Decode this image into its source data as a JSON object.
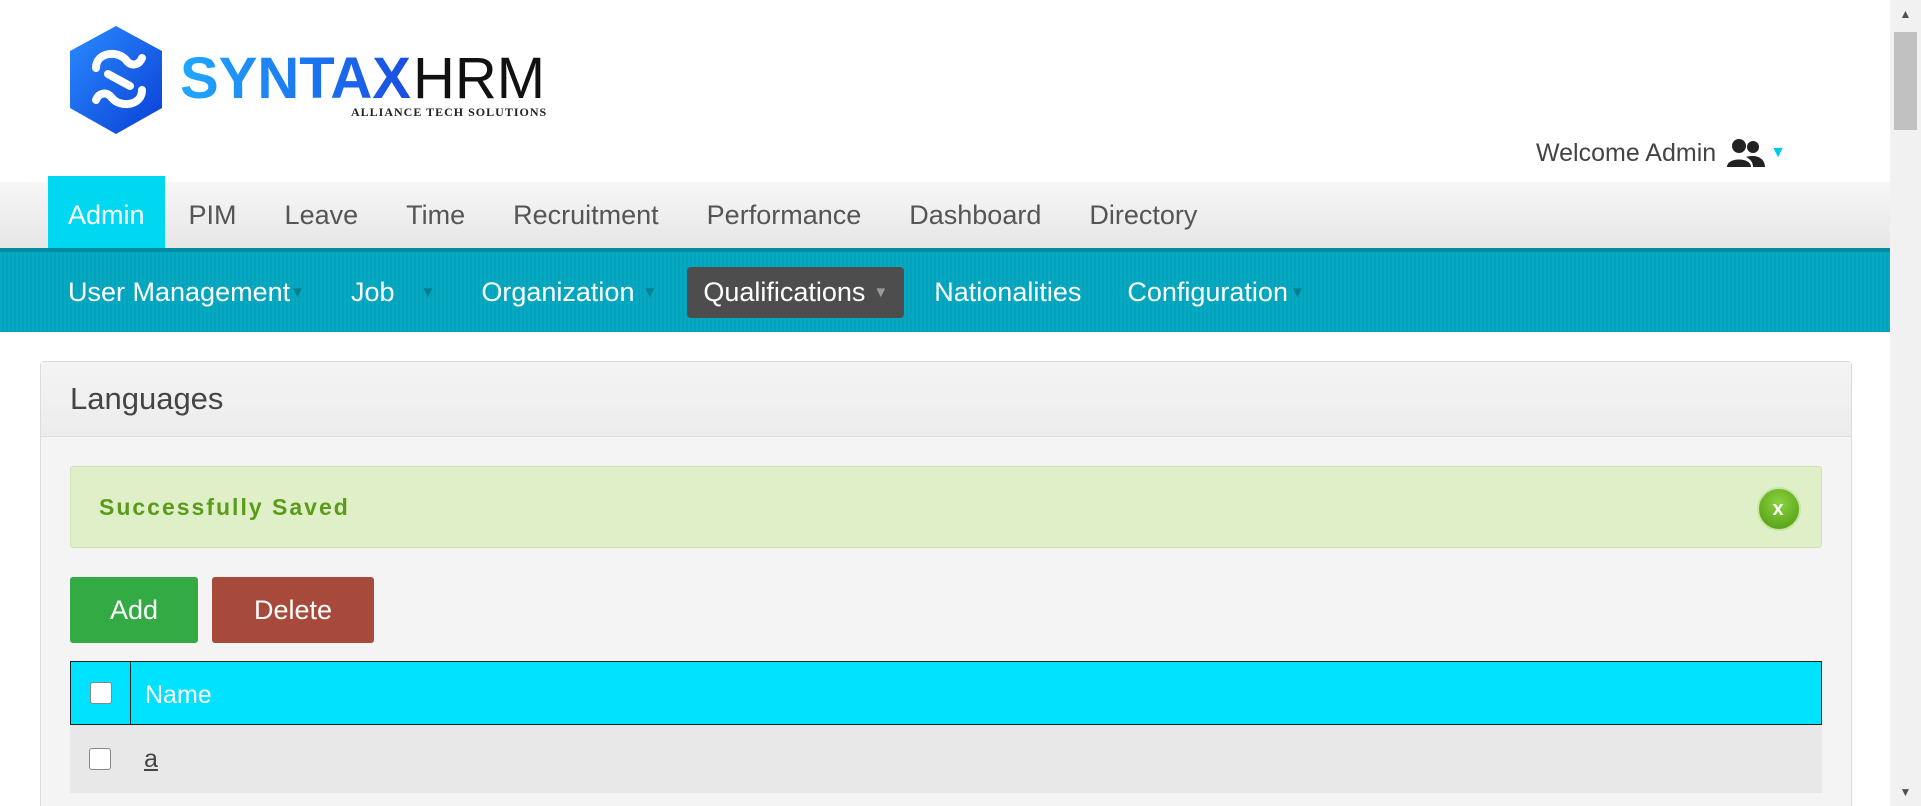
{
  "brand": {
    "logo_text_primary": "SYNTAX",
    "logo_text_secondary": "HRM",
    "tagline": "ALLIANCE TECH SOLUTIONS",
    "colors": {
      "primary": "#1a8cff",
      "secondary": "#111111"
    }
  },
  "header": {
    "welcome_text": "Welcome Admin",
    "user_icon": "users-icon"
  },
  "main_menu": {
    "items": [
      {
        "label": "Admin",
        "active": true
      },
      {
        "label": "PIM"
      },
      {
        "label": "Leave"
      },
      {
        "label": "Time"
      },
      {
        "label": "Recruitment"
      },
      {
        "label": "Performance"
      },
      {
        "label": "Dashboard"
      },
      {
        "label": "Directory"
      }
    ]
  },
  "sub_menu": {
    "items": [
      {
        "label": "User Management",
        "has_dropdown": true
      },
      {
        "label": "Job",
        "has_dropdown": true
      },
      {
        "label": "Organization",
        "has_dropdown": true
      },
      {
        "label": "Qualifications",
        "has_dropdown": true,
        "active": true
      },
      {
        "label": "Nationalities",
        "has_dropdown": false
      },
      {
        "label": "Configuration",
        "has_dropdown": true
      }
    ]
  },
  "panel": {
    "title": "Languages",
    "alert": {
      "message": "Successfully Saved",
      "close_label": "x"
    },
    "buttons": {
      "add": "Add",
      "delete": "Delete"
    },
    "table": {
      "columns": [
        "Name"
      ],
      "rows": [
        {
          "name": "a"
        }
      ]
    }
  },
  "colors": {
    "accent_cyan": "#00e2ff",
    "submenu_teal": "#05a9c1",
    "success_green": "#33aa44",
    "danger_red": "#a84a3b",
    "alert_bg": "#dff0c8"
  }
}
